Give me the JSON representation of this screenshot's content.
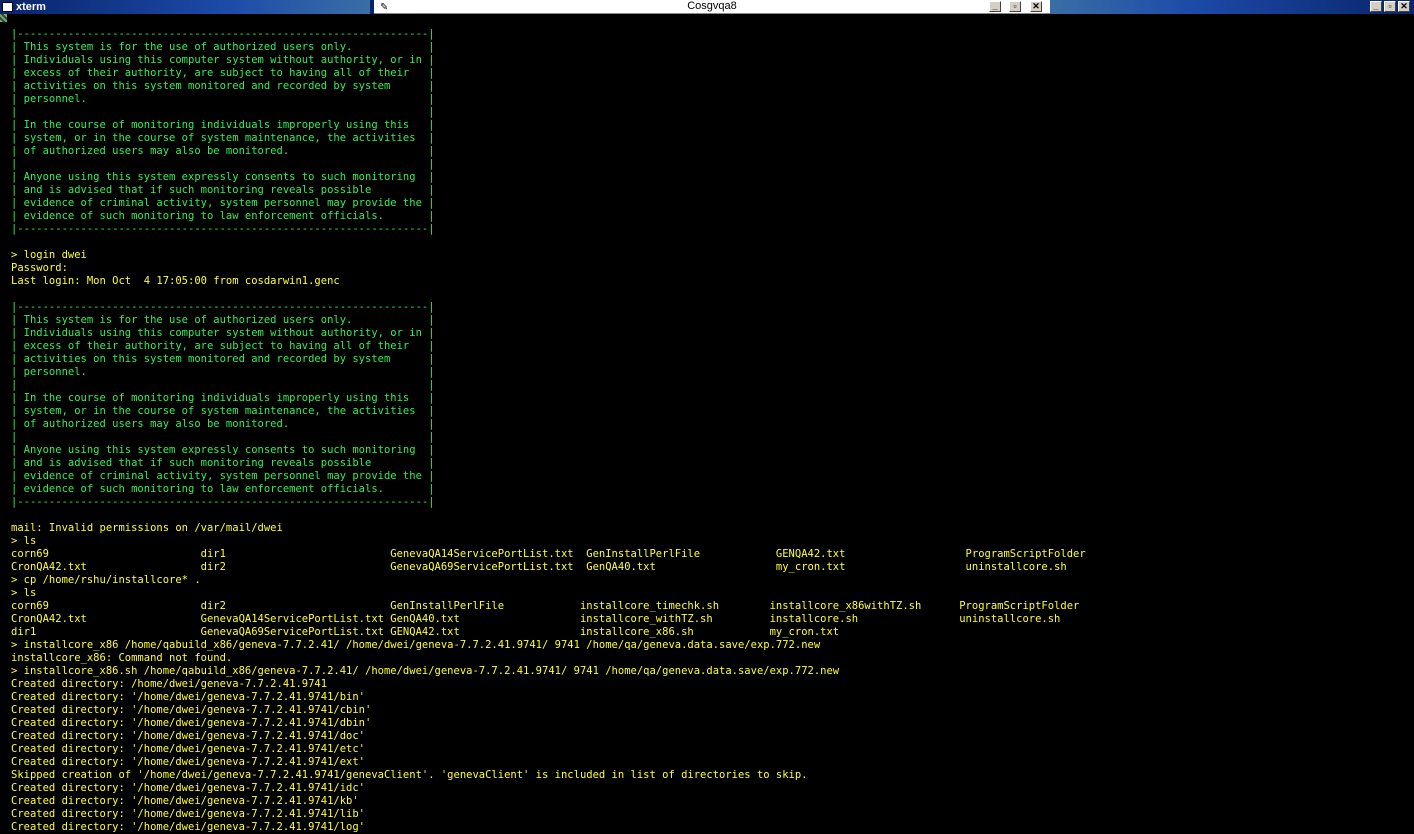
{
  "window": {
    "xterm_title": "xterm",
    "center_title": "Cosgvqa8",
    "buttons": {
      "minimize": "_",
      "restore": "▫",
      "close": "✕"
    }
  },
  "colors": {
    "banner": "#33ee55",
    "text": "#ffff33",
    "background": "#000000",
    "titlebar": "#0a246a"
  },
  "terminal": {
    "lines": [
      {
        "t": "|-----------------------------------------------------------------|",
        "g": true
      },
      {
        "t": "| This system is for the use of authorized users only.            |",
        "g": true
      },
      {
        "t": "| Individuals using this computer system without authority, or in |",
        "g": true
      },
      {
        "t": "| excess of their authority, are subject to having all of their   |",
        "g": true
      },
      {
        "t": "| activities on this system monitored and recorded by system      |",
        "g": true
      },
      {
        "t": "| personnel.                                                      |",
        "g": true
      },
      {
        "t": "|                                                                 |",
        "g": true
      },
      {
        "t": "| In the course of monitoring individuals improperly using this   |",
        "g": true
      },
      {
        "t": "| system, or in the course of system maintenance, the activities  |",
        "g": true
      },
      {
        "t": "| of authorized users may also be monitored.                      |",
        "g": true
      },
      {
        "t": "|                                                                 |",
        "g": true
      },
      {
        "t": "| Anyone using this system expressly consents to such monitoring  |",
        "g": true
      },
      {
        "t": "| and is advised that if such monitoring reveals possible         |",
        "g": true
      },
      {
        "t": "| evidence of criminal activity, system personnel may provide the |",
        "g": true
      },
      {
        "t": "| evidence of such monitoring to law enforcement officials.       |",
        "g": true
      },
      {
        "t": "|-----------------------------------------------------------------|",
        "g": true
      },
      {
        "t": "",
        "g": false
      },
      {
        "t": "> login dwei",
        "g": false
      },
      {
        "t": "Password:",
        "g": false
      },
      {
        "t": "Last login: Mon Oct  4 17:05:00 from cosdarwin1.genc",
        "g": false
      },
      {
        "t": "",
        "g": false
      },
      {
        "t": "|-----------------------------------------------------------------|",
        "g": true
      },
      {
        "t": "| This system is for the use of authorized users only.            |",
        "g": true
      },
      {
        "t": "| Individuals using this computer system without authority, or in |",
        "g": true
      },
      {
        "t": "| excess of their authority, are subject to having all of their   |",
        "g": true
      },
      {
        "t": "| activities on this system monitored and recorded by system      |",
        "g": true
      },
      {
        "t": "| personnel.                                                      |",
        "g": true
      },
      {
        "t": "|                                                                 |",
        "g": true
      },
      {
        "t": "| In the course of monitoring individuals improperly using this   |",
        "g": true
      },
      {
        "t": "| system, or in the course of system maintenance, the activities  |",
        "g": true
      },
      {
        "t": "| of authorized users may also be monitored.                      |",
        "g": true
      },
      {
        "t": "|                                                                 |",
        "g": true
      },
      {
        "t": "| Anyone using this system expressly consents to such monitoring  |",
        "g": true
      },
      {
        "t": "| and is advised that if such monitoring reveals possible         |",
        "g": true
      },
      {
        "t": "| evidence of criminal activity, system personnel may provide the |",
        "g": true
      },
      {
        "t": "| evidence of such monitoring to law enforcement officials.       |",
        "g": true
      },
      {
        "t": "|-----------------------------------------------------------------|",
        "g": true
      },
      {
        "t": "",
        "g": false
      },
      {
        "t": "mail: Invalid permissions on /var/mail/dwei",
        "g": false
      },
      {
        "t": "> ls",
        "g": false
      },
      {
        "t": "corn69                        dir1                          GenevaQA14ServicePortList.txt  GenInstallPerlFile            GENQA42.txt                   ProgramScriptFolder",
        "g": false
      },
      {
        "t": "CronQA42.txt                  dir2                          GenevaQA69ServicePortList.txt  GenQA40.txt                   my_cron.txt                   uninstallcore.sh",
        "g": false
      },
      {
        "t": "> cp /home/rshu/installcore* .",
        "g": false
      },
      {
        "t": "> ls",
        "g": false
      },
      {
        "t": "corn69                        dir2                          GenInstallPerlFile            installcore_timechk.sh        installcore_x86withTZ.sh      ProgramScriptFolder",
        "g": false
      },
      {
        "t": "CronQA42.txt                  GenevaQA14ServicePortList.txt GenQA40.txt                   installcore_withTZ.sh         installcore.sh                uninstallcore.sh",
        "g": false
      },
      {
        "t": "dir1                          GenevaQA69ServicePortList.txt GENQA42.txt                   installcore_x86.sh            my_cron.txt",
        "g": false
      },
      {
        "t": "> installcore_x86 /home/qabuild_x86/geneva-7.7.2.41/ /home/dwei/geneva-7.7.2.41.9741/ 9741 /home/qa/geneva.data.save/exp.772.new",
        "g": false
      },
      {
        "t": "installcore_x86: Command not found.",
        "g": false
      },
      {
        "t": "> installcore_x86.sh /home/qabuild_x86/geneva-7.7.2.41/ /home/dwei/geneva-7.7.2.41.9741/ 9741 /home/qa/geneva.data.save/exp.772.new",
        "g": false
      },
      {
        "t": "Created directory: /home/dwei/geneva-7.7.2.41.9741",
        "g": false
      },
      {
        "t": "Created directory: '/home/dwei/geneva-7.7.2.41.9741/bin'",
        "g": false
      },
      {
        "t": "Created directory: '/home/dwei/geneva-7.7.2.41.9741/cbin'",
        "g": false
      },
      {
        "t": "Created directory: '/home/dwei/geneva-7.7.2.41.9741/dbin'",
        "g": false
      },
      {
        "t": "Created directory: '/home/dwei/geneva-7.7.2.41.9741/doc'",
        "g": false
      },
      {
        "t": "Created directory: '/home/dwei/geneva-7.7.2.41.9741/etc'",
        "g": false
      },
      {
        "t": "Created directory: '/home/dwei/geneva-7.7.2.41.9741/ext'",
        "g": false
      },
      {
        "t": "Skipped creation of '/home/dwei/geneva-7.7.2.41.9741/genevaClient'. 'genevaClient' is included in list of directories to skip.",
        "g": false
      },
      {
        "t": "Created directory: '/home/dwei/geneva-7.7.2.41.9741/idc'",
        "g": false
      },
      {
        "t": "Created directory: '/home/dwei/geneva-7.7.2.41.9741/kb'",
        "g": false
      },
      {
        "t": "Created directory: '/home/dwei/geneva-7.7.2.41.9741/lib'",
        "g": false
      },
      {
        "t": "Created directory: '/home/dwei/geneva-7.7.2.41.9741/log'",
        "g": false
      }
    ]
  }
}
